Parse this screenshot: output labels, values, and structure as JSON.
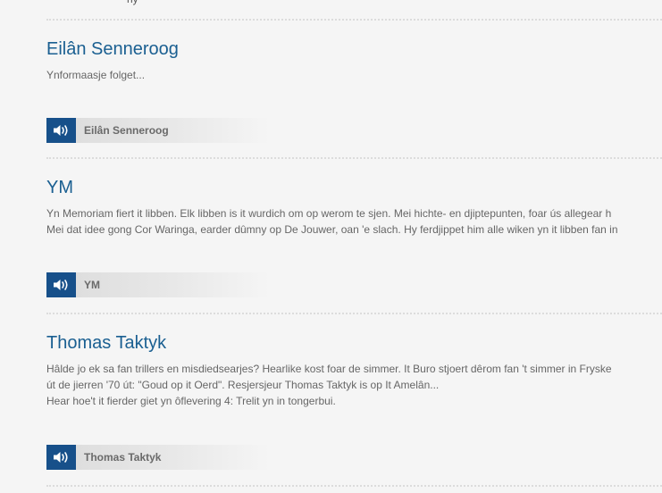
{
  "top_fragment": "ny",
  "programs": [
    {
      "title": "Eilân Senneroog",
      "description": [
        "Ynformaasje folget..."
      ],
      "audio_label": "Eilân Senneroog",
      "audio_icon": "speaker-icon"
    },
    {
      "title": "YM",
      "description": [
        "Yn Memoriam fiert it libben. Elk libben is it wurdich om op werom te sjen. Mei hichte- en djiptepunten, foar ús allegear h",
        "Mei dat idee gong Cor Waringa, earder dûmny op De Jouwer, oan 'e slach. Hy ferdjippet him alle wiken yn it libben fan in"
      ],
      "audio_label": "YM",
      "audio_icon": "speaker-icon"
    },
    {
      "title": "Thomas Taktyk",
      "description": [
        "Hâlde jo ek sa fan trillers en misdiedsearjes? Hearlike kost foar de simmer. It Buro stjoert dêrom fan 't simmer in Fryske",
        "út de jierren '70 út: \"Goud op it Oerd\". Resjersjeur Thomas Taktyk is op It Amelân...",
        "Hear hoe't it fierder giet yn ôflevering 4: Trelit yn in tongerbui."
      ],
      "audio_label": "Thomas Taktyk",
      "audio_icon": "speaker-icon"
    }
  ],
  "colors": {
    "title": "#1a5f91",
    "audio_button": "#17508a",
    "background": "#f5f5f5"
  }
}
